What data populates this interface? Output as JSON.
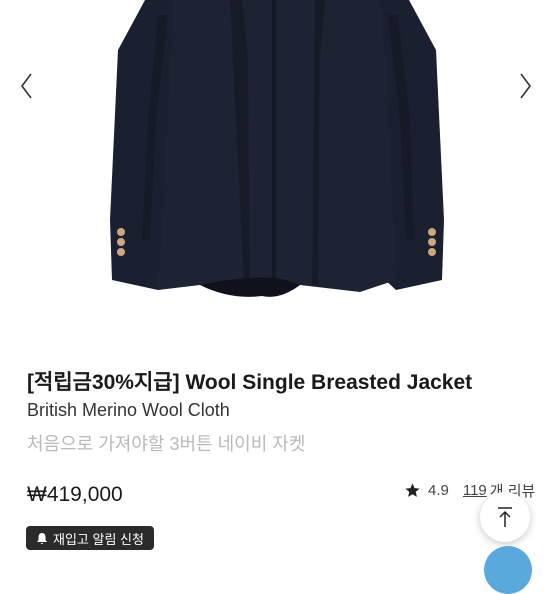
{
  "product": {
    "title": "[적립금30%지급] Wool Single Breasted Jacket",
    "subtitle": "British Merino Wool Cloth",
    "description": "처음으로 가져야할 3버튼 네이비 자켓",
    "price": "₩419,000"
  },
  "rating": {
    "score": "4.9",
    "review_count": "119",
    "review_label": "개 리뷰"
  },
  "buttons": {
    "restock_label": "재입고 알림 신청"
  },
  "icons": {
    "prev": "chevron-left-icon",
    "next": "chevron-right-icon",
    "star": "star-icon",
    "bell": "bell-icon",
    "scroll_top": "arrow-up-icon"
  },
  "colors": {
    "jacket": "#1d2230",
    "button_dark": "#2b2b2b",
    "muted_text": "#b9b9b9",
    "chat_bubble": "#5aa9dc"
  }
}
